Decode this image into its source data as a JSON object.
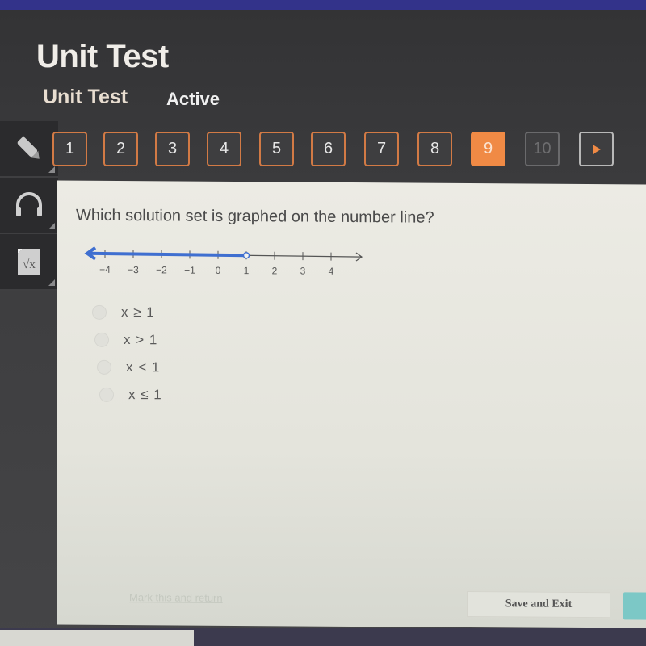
{
  "header": {
    "title": "Unit Test",
    "subtitle": "Unit Test",
    "status": "Active"
  },
  "sidebar": {
    "tools": [
      {
        "name": "pencil",
        "icon": "pencil-icon"
      },
      {
        "name": "audio",
        "icon": "headphones-icon"
      },
      {
        "name": "math",
        "icon": "square-root-icon",
        "glyph": "√x"
      }
    ]
  },
  "question_nav": {
    "items": [
      {
        "label": "1",
        "state": "answered"
      },
      {
        "label": "2",
        "state": "answered"
      },
      {
        "label": "3",
        "state": "answered"
      },
      {
        "label": "4",
        "state": "answered"
      },
      {
        "label": "5",
        "state": "answered"
      },
      {
        "label": "6",
        "state": "answered"
      },
      {
        "label": "7",
        "state": "answered"
      },
      {
        "label": "8",
        "state": "answered"
      },
      {
        "label": "9",
        "state": "current"
      },
      {
        "label": "10",
        "state": "disabled"
      }
    ],
    "next_icon": "play-arrow-icon",
    "current_color": "#f08a45",
    "border_color": "#d27a45"
  },
  "question": {
    "text": "Which solution set is graphed on the number line?",
    "number_line": {
      "ticks": [
        "−4",
        "−3",
        "−2",
        "−1",
        "0",
        "1",
        "2",
        "3",
        "4"
      ],
      "shaded_direction": "left",
      "endpoint": 1,
      "endpoint_type": "open",
      "shade_color": "#3f6fd0"
    },
    "choices": [
      {
        "label": "x ≥ 1"
      },
      {
        "label": "x > 1"
      },
      {
        "label": "x < 1"
      },
      {
        "label": "x ≤ 1"
      }
    ]
  },
  "footer": {
    "mark_link": "Mark this and return",
    "save_exit": "Save and Exit"
  }
}
